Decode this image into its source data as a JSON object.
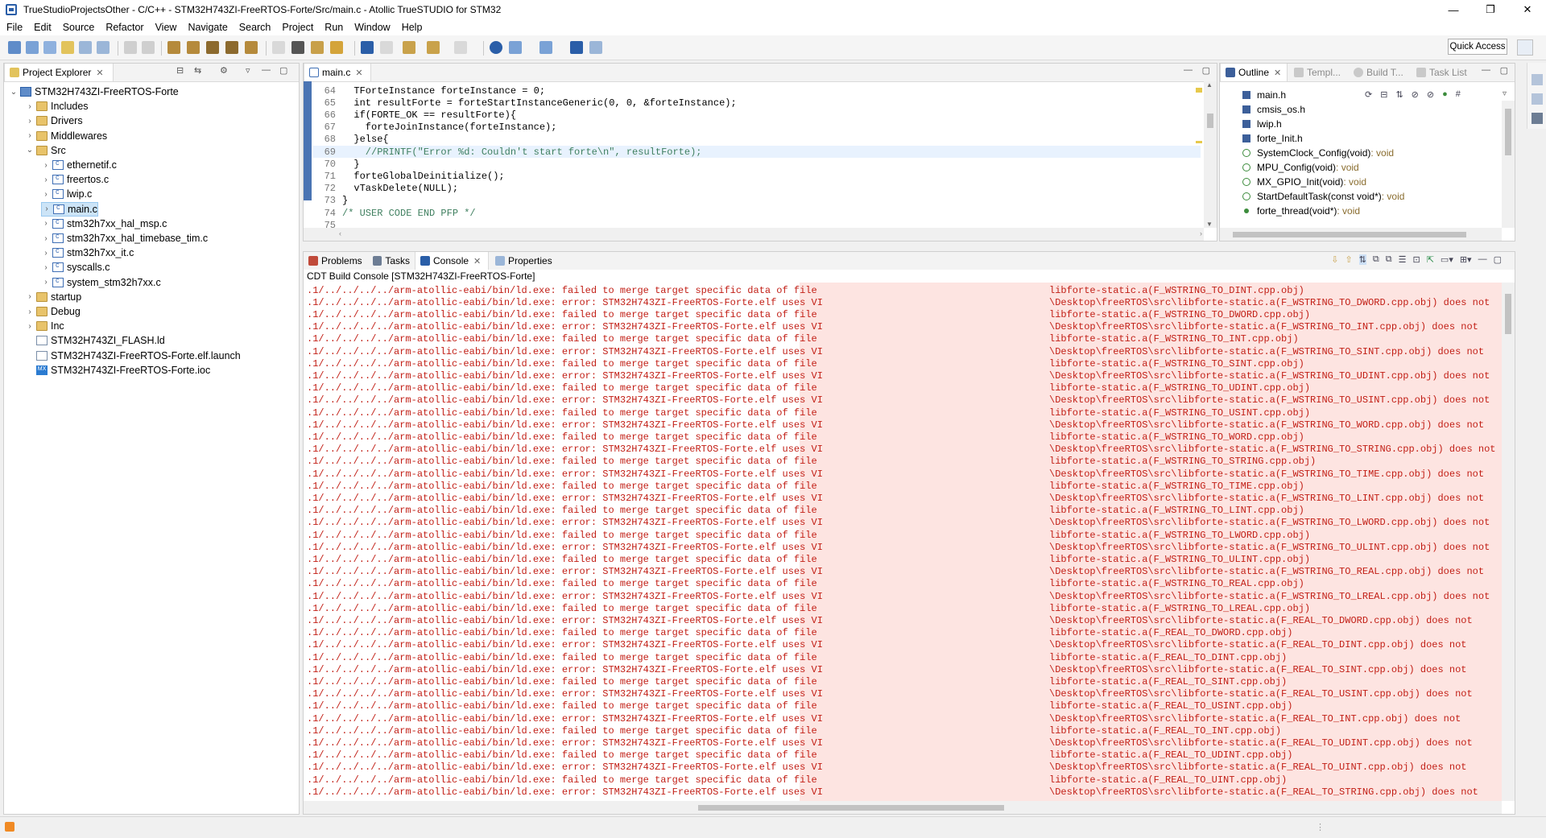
{
  "window": {
    "title": "TrueStudioProjectsOther - C/C++ - STM32H743ZI-FreeRTOS-Forte/Src/main.c - Atollic TrueSTUDIO for STM32",
    "controls": {
      "minimize": "—",
      "maximize": "❐",
      "close": "✕"
    }
  },
  "menu": [
    "File",
    "Edit",
    "Source",
    "Refactor",
    "View",
    "Navigate",
    "Search",
    "Project",
    "Run",
    "Window",
    "Help"
  ],
  "toolbar": {
    "quick_access": "Quick Access"
  },
  "project_explorer": {
    "tab_label": "Project Explorer",
    "tree": [
      {
        "label": "STM32H743ZI-FreeRTOS-Forte",
        "icon": "project-icon",
        "arrow": "⌄",
        "depth": 0
      },
      {
        "label": "Includes",
        "icon": "folder-icon",
        "arrow": "›",
        "depth": 1
      },
      {
        "label": "Drivers",
        "icon": "folder-icon",
        "arrow": "›",
        "depth": 1
      },
      {
        "label": "Middlewares",
        "icon": "folder-icon",
        "arrow": "›",
        "depth": 1
      },
      {
        "label": "Src",
        "icon": "folder-icon",
        "arrow": "⌄",
        "depth": 1
      },
      {
        "label": "ethernetif.c",
        "icon": "c-file-icon",
        "arrow": "›",
        "depth": 2
      },
      {
        "label": "freertos.c",
        "icon": "c-file-icon",
        "arrow": "›",
        "depth": 2
      },
      {
        "label": "lwip.c",
        "icon": "c-file-icon",
        "arrow": "›",
        "depth": 2
      },
      {
        "label": "main.c",
        "icon": "c-file-icon",
        "arrow": "›",
        "depth": 2,
        "selected": true
      },
      {
        "label": "stm32h7xx_hal_msp.c",
        "icon": "c-file-icon",
        "arrow": "›",
        "depth": 2
      },
      {
        "label": "stm32h7xx_hal_timebase_tim.c",
        "icon": "c-file-icon",
        "arrow": "›",
        "depth": 2
      },
      {
        "label": "stm32h7xx_it.c",
        "icon": "c-file-icon",
        "arrow": "›",
        "depth": 2
      },
      {
        "label": "syscalls.c",
        "icon": "c-file-icon",
        "arrow": "›",
        "depth": 2
      },
      {
        "label": "system_stm32h7xx.c",
        "icon": "c-file-icon",
        "arrow": "›",
        "depth": 2
      },
      {
        "label": "startup",
        "icon": "folder-icon",
        "arrow": "›",
        "depth": 1
      },
      {
        "label": "Debug",
        "icon": "folder-icon",
        "arrow": "›",
        "depth": 1
      },
      {
        "label": "Inc",
        "icon": "folder-icon",
        "arrow": "›",
        "depth": 1
      },
      {
        "label": "STM32H743ZI_FLASH.ld",
        "icon": "file-icon",
        "arrow": "",
        "depth": 1
      },
      {
        "label": "STM32H743ZI-FreeRTOS-Forte.elf.launch",
        "icon": "file-icon",
        "arrow": "",
        "depth": 1
      },
      {
        "label": "STM32H743ZI-FreeRTOS-Forte.ioc",
        "icon": "mx-icon",
        "arrow": "",
        "depth": 1
      }
    ]
  },
  "editor": {
    "tab_label": "main.c",
    "lines": [
      {
        "num": "64",
        "text": "  TForteInstance forteInstance = 0;"
      },
      {
        "num": "65",
        "text": "  int resultForte = forteStartInstanceGeneric(0, 0, &forteInstance);"
      },
      {
        "num": "66",
        "text": "  if(FORTE_OK == resultForte){"
      },
      {
        "num": "67",
        "text": "    forteJoinInstance(forteInstance);"
      },
      {
        "num": "68",
        "text": "  }else{"
      },
      {
        "num": "69",
        "text": "    //PRINTF(\"Error %d: Couldn't start forte\\n\", resultForte);"
      },
      {
        "num": "70",
        "text": "  }"
      },
      {
        "num": "71",
        "text": "  forteGlobalDeinitialize();"
      },
      {
        "num": "72",
        "text": "  vTaskDelete(NULL);"
      },
      {
        "num": "73",
        "text": "}"
      },
      {
        "num": "74",
        "text": "/* USER CODE END PFP */"
      },
      {
        "num": "75",
        "text": ""
      }
    ]
  },
  "outline": {
    "tabs": [
      "Outline",
      "Templ...",
      "Build T...",
      "Task List"
    ],
    "items": [
      {
        "label": "main.h",
        "type": "",
        "kind": "include"
      },
      {
        "label": "cmsis_os.h",
        "type": "",
        "kind": "include"
      },
      {
        "label": "lwip.h",
        "type": "",
        "kind": "include"
      },
      {
        "label": "forte_Init.h",
        "type": "",
        "kind": "include"
      },
      {
        "label": "SystemClock_Config(void)",
        "type": " : void",
        "kind": "function"
      },
      {
        "label": "MPU_Config(void)",
        "type": " : void",
        "kind": "function"
      },
      {
        "label": "MX_GPIO_Init(void)",
        "type": " : void",
        "kind": "function"
      },
      {
        "label": "StartDefaultTask(const void*)",
        "type": " : void",
        "kind": "function"
      },
      {
        "label": "forte_thread(void*)",
        "type": " : void",
        "kind": "private"
      }
    ]
  },
  "console": {
    "tabs": [
      "Problems",
      "Tasks",
      "Console",
      "Properties"
    ],
    "subtitle": "CDT Build Console [STM32H743ZI-FreeRTOS-Forte]",
    "left": [
      ".1/../../../../arm-atollic-eabi/bin/ld.exe: failed to merge target specific data of file",
      ".1/../../../../arm-atollic-eabi/bin/ld.exe: error: STM32H743ZI-FreeRTOS-Forte.elf uses VI",
      ".1/../../../../arm-atollic-eabi/bin/ld.exe: failed to merge target specific data of file",
      ".1/../../../../arm-atollic-eabi/bin/ld.exe: error: STM32H743ZI-FreeRTOS-Forte.elf uses VI",
      ".1/../../../../arm-atollic-eabi/bin/ld.exe: failed to merge target specific data of file",
      ".1/../../../../arm-atollic-eabi/bin/ld.exe: error: STM32H743ZI-FreeRTOS-Forte.elf uses VI",
      ".1/../../../../arm-atollic-eabi/bin/ld.exe: failed to merge target specific data of file",
      ".1/../../../../arm-atollic-eabi/bin/ld.exe: error: STM32H743ZI-FreeRTOS-Forte.elf uses VI",
      ".1/../../../../arm-atollic-eabi/bin/ld.exe: failed to merge target specific data of file",
      ".1/../../../../arm-atollic-eabi/bin/ld.exe: error: STM32H743ZI-FreeRTOS-Forte.elf uses VI",
      ".1/../../../../arm-atollic-eabi/bin/ld.exe: failed to merge target specific data of file",
      ".1/../../../../arm-atollic-eabi/bin/ld.exe: error: STM32H743ZI-FreeRTOS-Forte.elf uses VI",
      ".1/../../../../arm-atollic-eabi/bin/ld.exe: failed to merge target specific data of file",
      ".1/../../../../arm-atollic-eabi/bin/ld.exe: error: STM32H743ZI-FreeRTOS-Forte.elf uses VI",
      ".1/../../../../arm-atollic-eabi/bin/ld.exe: failed to merge target specific data of file",
      ".1/../../../../arm-atollic-eabi/bin/ld.exe: error: STM32H743ZI-FreeRTOS-Forte.elf uses VI",
      ".1/../../../../arm-atollic-eabi/bin/ld.exe: failed to merge target specific data of file",
      ".1/../../../../arm-atollic-eabi/bin/ld.exe: error: STM32H743ZI-FreeRTOS-Forte.elf uses VI",
      ".1/../../../../arm-atollic-eabi/bin/ld.exe: failed to merge target specific data of file",
      ".1/../../../../arm-atollic-eabi/bin/ld.exe: error: STM32H743ZI-FreeRTOS-Forte.elf uses VI",
      ".1/../../../../arm-atollic-eabi/bin/ld.exe: failed to merge target specific data of file",
      ".1/../../../../arm-atollic-eabi/bin/ld.exe: error: STM32H743ZI-FreeRTOS-Forte.elf uses VI",
      ".1/../../../../arm-atollic-eabi/bin/ld.exe: failed to merge target specific data of file",
      ".1/../../../../arm-atollic-eabi/bin/ld.exe: error: STM32H743ZI-FreeRTOS-Forte.elf uses VI",
      ".1/../../../../arm-atollic-eabi/bin/ld.exe: failed to merge target specific data of file",
      ".1/../../../../arm-atollic-eabi/bin/ld.exe: error: STM32H743ZI-FreeRTOS-Forte.elf uses VI",
      ".1/../../../../arm-atollic-eabi/bin/ld.exe: failed to merge target specific data of file",
      ".1/../../../../arm-atollic-eabi/bin/ld.exe: error: STM32H743ZI-FreeRTOS-Forte.elf uses VI",
      ".1/../../../../arm-atollic-eabi/bin/ld.exe: failed to merge target specific data of file",
      ".1/../../../../arm-atollic-eabi/bin/ld.exe: error: STM32H743ZI-FreeRTOS-Forte.elf uses VI",
      ".1/../../../../arm-atollic-eabi/bin/ld.exe: failed to merge target specific data of file",
      ".1/../../../../arm-atollic-eabi/bin/ld.exe: error: STM32H743ZI-FreeRTOS-Forte.elf uses VI",
      ".1/../../../../arm-atollic-eabi/bin/ld.exe: failed to merge target specific data of file",
      ".1/../../../../arm-atollic-eabi/bin/ld.exe: error: STM32H743ZI-FreeRTOS-Forte.elf uses VI",
      ".1/../../../../arm-atollic-eabi/bin/ld.exe: failed to merge target specific data of file",
      ".1/../../../../arm-atollic-eabi/bin/ld.exe: error: STM32H743ZI-FreeRTOS-Forte.elf uses VI",
      ".1/../../../../arm-atollic-eabi/bin/ld.exe: failed to merge target specific data of file",
      ".1/../../../../arm-atollic-eabi/bin/ld.exe: error: STM32H743ZI-FreeRTOS-Forte.elf uses VI",
      ".1/../../../../arm-atollic-eabi/bin/ld.exe: failed to merge target specific data of file",
      ".1/../../../../arm-atollic-eabi/bin/ld.exe: error: STM32H743ZI-FreeRTOS-Forte.elf uses VI",
      ".1/../../../../arm-atollic-eabi/bin/ld.exe: failed to merge target specific data of file",
      ".1/../../../../arm-atollic-eabi/bin/ld.exe: error: STM32H743ZI-FreeRTOS-Forte.elf uses VI"
    ],
    "right": [
      "libforte-static.a(F_WSTRING_TO_DINT.cpp.obj)",
      "\\Desktop\\freeRTOS\\src\\libforte-static.a(F_WSTRING_TO_DWORD.cpp.obj) does not",
      "libforte-static.a(F_WSTRING_TO_DWORD.cpp.obj)",
      "\\Desktop\\freeRTOS\\src\\libforte-static.a(F_WSTRING_TO_INT.cpp.obj) does not",
      "libforte-static.a(F_WSTRING_TO_INT.cpp.obj)",
      "\\Desktop\\freeRTOS\\src\\libforte-static.a(F_WSTRING_TO_SINT.cpp.obj) does not",
      "libforte-static.a(F_WSTRING_TO_SINT.cpp.obj)",
      "\\Desktop\\freeRTOS\\src\\libforte-static.a(F_WSTRING_TO_UDINT.cpp.obj) does not",
      "libforte-static.a(F_WSTRING_TO_UDINT.cpp.obj)",
      "\\Desktop\\freeRTOS\\src\\libforte-static.a(F_WSTRING_TO_USINT.cpp.obj) does not",
      "libforte-static.a(F_WSTRING_TO_USINT.cpp.obj)",
      "\\Desktop\\freeRTOS\\src\\libforte-static.a(F_WSTRING_TO_WORD.cpp.obj) does not",
      "libforte-static.a(F_WSTRING_TO_WORD.cpp.obj)",
      "\\Desktop\\freeRTOS\\src\\libforte-static.a(F_WSTRING_TO_STRING.cpp.obj) does not",
      "libforte-static.a(F_WSTRING_TO_STRING.cpp.obj)",
      "\\Desktop\\freeRTOS\\src\\libforte-static.a(F_WSTRING_TO_TIME.cpp.obj) does not",
      "libforte-static.a(F_WSTRING_TO_TIME.cpp.obj)",
      "\\Desktop\\freeRTOS\\src\\libforte-static.a(F_WSTRING_TO_LINT.cpp.obj) does not",
      "libforte-static.a(F_WSTRING_TO_LINT.cpp.obj)",
      "\\Desktop\\freeRTOS\\src\\libforte-static.a(F_WSTRING_TO_LWORD.cpp.obj) does not",
      "libforte-static.a(F_WSTRING_TO_LWORD.cpp.obj)",
      "\\Desktop\\freeRTOS\\src\\libforte-static.a(F_WSTRING_TO_ULINT.cpp.obj) does not",
      "libforte-static.a(F_WSTRING_TO_ULINT.cpp.obj)",
      "\\Desktop\\freeRTOS\\src\\libforte-static.a(F_WSTRING_TO_REAL.cpp.obj) does not",
      "libforte-static.a(F_WSTRING_TO_REAL.cpp.obj)",
      "\\Desktop\\freeRTOS\\src\\libforte-static.a(F_WSTRING_TO_LREAL.cpp.obj) does not",
      "libforte-static.a(F_WSTRING_TO_LREAL.cpp.obj)",
      "\\Desktop\\freeRTOS\\src\\libforte-static.a(F_REAL_TO_DWORD.cpp.obj) does not",
      "libforte-static.a(F_REAL_TO_DWORD.cpp.obj)",
      "\\Desktop\\freeRTOS\\src\\libforte-static.a(F_REAL_TO_DINT.cpp.obj) does not",
      "libforte-static.a(F_REAL_TO_DINT.cpp.obj)",
      "\\Desktop\\freeRTOS\\src\\libforte-static.a(F_REAL_TO_SINT.cpp.obj) does not",
      "libforte-static.a(F_REAL_TO_SINT.cpp.obj)",
      "\\Desktop\\freeRTOS\\src\\libforte-static.a(F_REAL_TO_USINT.cpp.obj) does not",
      "libforte-static.a(F_REAL_TO_USINT.cpp.obj)",
      "\\Desktop\\freeRTOS\\src\\libforte-static.a(F_REAL_TO_INT.cpp.obj) does not",
      "libforte-static.a(F_REAL_TO_INT.cpp.obj)",
      "\\Desktop\\freeRTOS\\src\\libforte-static.a(F_REAL_TO_UDINT.cpp.obj) does not",
      "libforte-static.a(F_REAL_TO_UDINT.cpp.obj)",
      "\\Desktop\\freeRTOS\\src\\libforte-static.a(F_REAL_TO_UINT.cpp.obj) does not",
      "libforte-static.a(F_REAL_TO_UINT.cpp.obj)",
      "\\Desktop\\freeRTOS\\src\\libforte-static.a(F_REAL_TO_STRING.cpp.obj) does not"
    ]
  },
  "colors": {
    "accent": "#2a5ea8",
    "console_error": "#c21f16",
    "console_bg": "#fde4e1",
    "selection": "#cce4f7"
  }
}
